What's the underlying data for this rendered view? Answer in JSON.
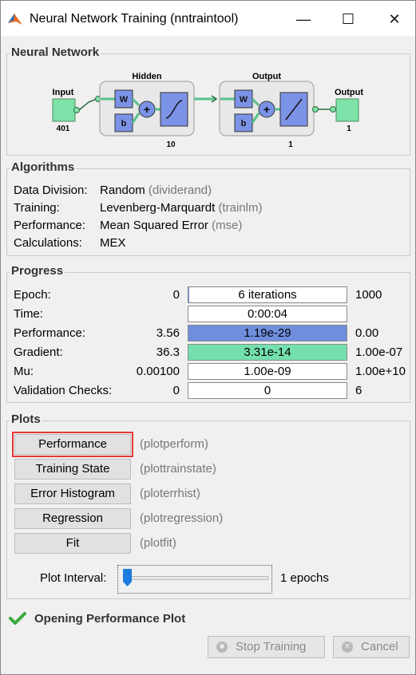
{
  "window": {
    "title": "Neural Network Training (nntraintool)",
    "minimize": "—",
    "maximize": "☐",
    "close": "✕"
  },
  "network": {
    "group_label": "Neural Network",
    "input_label": "Input",
    "input_size": "401",
    "hidden_label": "Hidden",
    "hidden_size": "10",
    "output_layer_label": "Output",
    "output_layer_size": "1",
    "output_label": "Output",
    "output_size": "1",
    "w": "W",
    "b": "b",
    "plus": "+"
  },
  "algorithms": {
    "group_label": "Algorithms",
    "rows": [
      {
        "key": "Data Division:",
        "value": "Random",
        "fn": "(dividerand)"
      },
      {
        "key": "Training:",
        "value": "Levenberg-Marquardt",
        "fn": "(trainlm)"
      },
      {
        "key": "Performance:",
        "value": "Mean Squared Error",
        "fn": "(mse)"
      },
      {
        "key": "Calculations:",
        "value": "MEX",
        "fn": ""
      }
    ]
  },
  "progress": {
    "group_label": "Progress",
    "rows": [
      {
        "label": "Epoch:",
        "low": "0",
        "value": "6 iterations",
        "high": "1000",
        "fill": 0.006,
        "fill_color": "#6f8fde"
      },
      {
        "label": "Time:",
        "low": "",
        "value": "0:00:04",
        "high": "",
        "fill": 0,
        "fill_color": "#6f8fde"
      },
      {
        "label": "Performance:",
        "low": "3.56",
        "value": "1.19e-29",
        "high": "0.00",
        "fill": 1.0,
        "fill_color": "#6f8fde"
      },
      {
        "label": "Gradient:",
        "low": "36.3",
        "value": "3.31e-14",
        "high": "1.00e-07",
        "fill": 1.0,
        "fill_color": "#74e0ae"
      },
      {
        "label": "Mu:",
        "low": "0.00100",
        "value": "1.00e-09",
        "high": "1.00e+10",
        "fill": 0,
        "fill_color": "#6f8fde"
      },
      {
        "label": "Validation Checks:",
        "low": "0",
        "value": "0",
        "high": "6",
        "fill": 0,
        "fill_color": "#6f8fde"
      }
    ]
  },
  "plots": {
    "group_label": "Plots",
    "buttons": [
      {
        "label": "Performance",
        "fn": "(plotperform)"
      },
      {
        "label": "Training State",
        "fn": "(plottrainstate)"
      },
      {
        "label": "Error Histogram",
        "fn": "(ploterrhist)"
      },
      {
        "label": "Regression",
        "fn": "(plotregression)"
      },
      {
        "label": "Fit",
        "fn": "(plotfit)"
      }
    ],
    "interval_label": "Plot Interval:",
    "interval_value": "1 epochs",
    "interval_fraction": 0.0
  },
  "status": {
    "text": "Opening Performance Plot"
  },
  "actions": {
    "stop_label": "Stop Training",
    "cancel_label": "Cancel"
  },
  "colors": {
    "highlight_border": "#e53935",
    "node_green": "#7ee3a8",
    "block_blue": "#7b93e6",
    "check_green": "#3cab3c"
  }
}
